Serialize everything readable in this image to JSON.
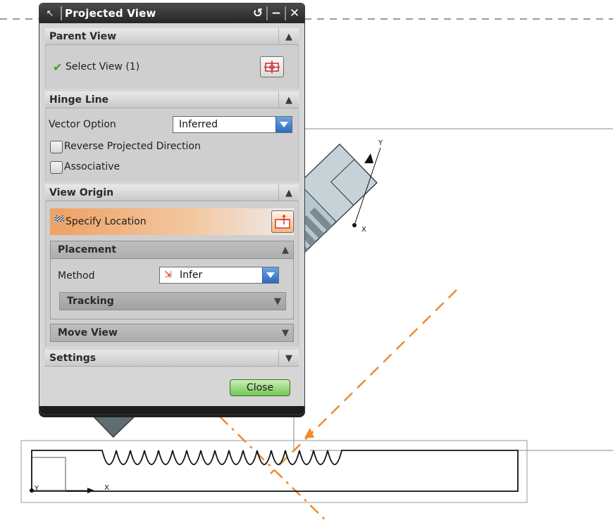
{
  "dialog": {
    "title": "Projected View",
    "parent_view": {
      "header": "Parent View",
      "select_label": "Select View (1)"
    },
    "hinge_line": {
      "header": "Hinge Line",
      "vector_option_label": "Vector Option",
      "vector_option_value": "Inferred",
      "reverse_label": "Reverse Projected Direction",
      "associative_label": "Associative"
    },
    "view_origin": {
      "header": "View Origin",
      "specify_location_label": "Specify Location",
      "placement_header": "Placement",
      "method_label": "Method",
      "method_value": "Infer",
      "tracking_header": "Tracking",
      "move_view_header": "Move View"
    },
    "settings": {
      "header": "Settings"
    },
    "close_label": "Close"
  },
  "canvas": {
    "axis_labels": {
      "x": "X",
      "y": "Y"
    }
  },
  "colors": {
    "accent_orange": "#f08a2c",
    "part_fill": "#b7c7cf",
    "part_dark": "#6f7f86",
    "check_green": "#3aa01a"
  }
}
